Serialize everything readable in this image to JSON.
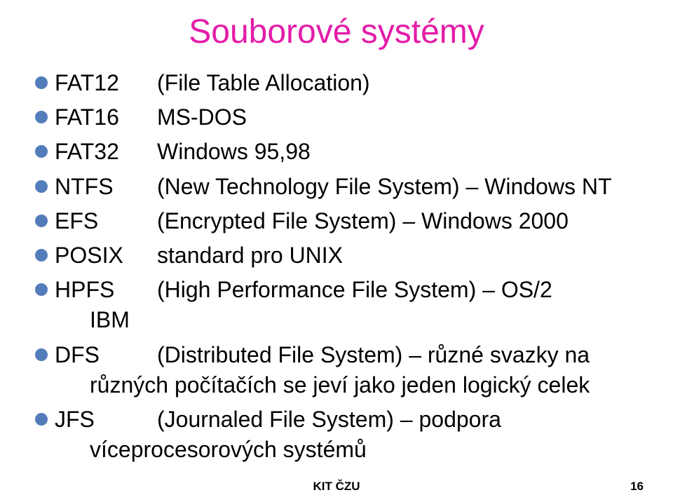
{
  "title": "Souborové systémy",
  "items": [
    {
      "label": "FAT12",
      "desc": "(File Table Allocation)"
    },
    {
      "label": "FAT16",
      "desc": "MS-DOS"
    },
    {
      "label": "FAT32",
      "desc": "Windows 95,98"
    },
    {
      "label": "NTFS",
      "desc": "(New Technology File System) – Windows NT"
    },
    {
      "label": "EFS",
      "desc": "(Encrypted File System) – Windows 2000"
    },
    {
      "label": "POSIX",
      "desc": "standard pro UNIX"
    },
    {
      "label": "HPFS",
      "desc": "(High Performance File System) – OS/2",
      "sub": "IBM"
    },
    {
      "label": "DFS",
      "desc": "(Distributed File System) – různé svazky na",
      "cont": "různých počítačích se jeví jako jeden logický celek"
    },
    {
      "label": "JFS",
      "desc": "(Journaled File System) – podpora",
      "cont": "víceprocesorových systémů"
    }
  ],
  "footer": {
    "center": "KIT ČZU",
    "page": "16"
  }
}
